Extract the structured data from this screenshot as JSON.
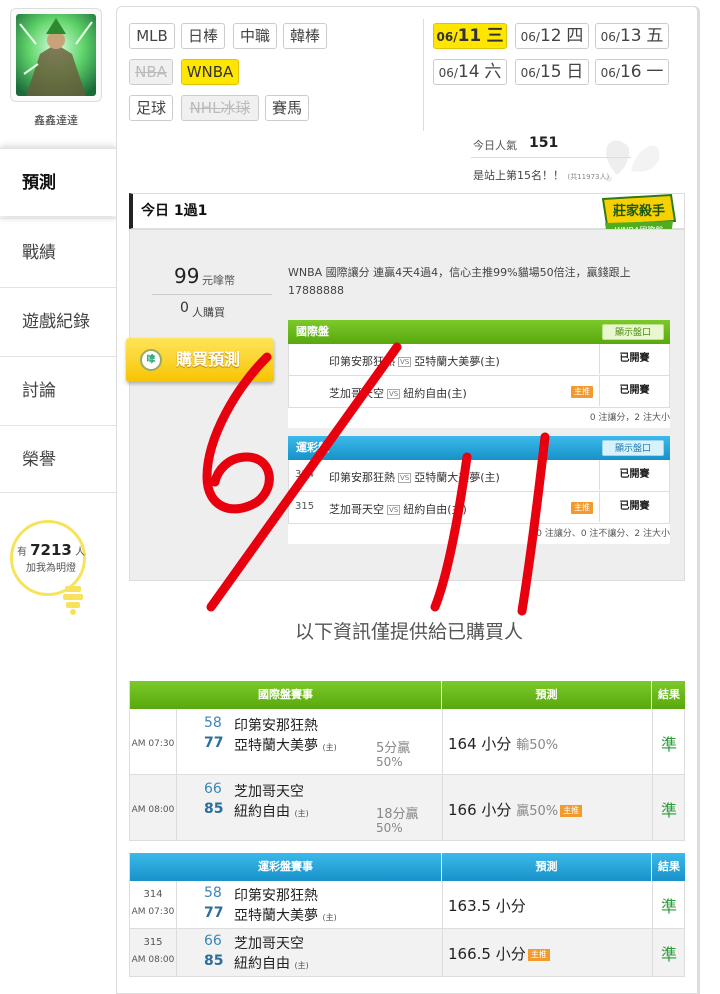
{
  "sidebar": {
    "username": "鑫鑫達達",
    "items": [
      {
        "label": "預測"
      },
      {
        "label": "戰績"
      },
      {
        "label": "遊戲紀錄"
      },
      {
        "label": "討論"
      },
      {
        "label": "榮譽"
      }
    ],
    "bulb": {
      "prefix": "有",
      "count": "7213",
      "suffix": "人",
      "line2": "加我為明燈"
    }
  },
  "sports": [
    {
      "label": "MLB",
      "state": "normal"
    },
    {
      "label": "日棒",
      "state": "normal"
    },
    {
      "label": "中職",
      "state": "normal"
    },
    {
      "label": "韓棒",
      "state": "normal"
    },
    {
      "label": "NBA",
      "state": "disabled"
    },
    {
      "label": "WNBA",
      "state": "active"
    },
    {
      "label": "足球",
      "state": "normal"
    },
    {
      "label": "NHL冰球",
      "state": "disabled"
    },
    {
      "label": "賽馬",
      "state": "normal"
    }
  ],
  "dates": [
    {
      "md": "06/",
      "day": "11",
      "dow": "三",
      "active": true
    },
    {
      "md": "06/",
      "day": "12",
      "dow": "四",
      "active": false
    },
    {
      "md": "06/",
      "day": "13",
      "dow": "五",
      "active": false
    },
    {
      "md": "06/",
      "day": "14",
      "dow": "六",
      "active": false
    },
    {
      "md": "06/",
      "day": "15",
      "dow": "日",
      "active": false
    },
    {
      "md": "06/",
      "day": "16",
      "dow": "一",
      "active": false
    }
  ],
  "stats": {
    "pop_label": "今日人氣",
    "pop_value": "151",
    "rank_text": "是站上第15名！！",
    "rank_small": "(共11973人)"
  },
  "today": {
    "title": "今日 1過1",
    "badge_top": "莊家殺手",
    "badge_sub": "WNBA國際盤",
    "price": "99",
    "price_unit": "元嗱幣",
    "buyers": "0",
    "buyers_unit": "人購買",
    "buy_label": "購買預測",
    "coin": "嗱",
    "description": "WNBA 國際讓分 連贏4天4過4，信心主推99%貓場50倍注，贏錢跟上 17888888",
    "show_btn": "顯示盤口",
    "intl": {
      "header": "國際盤",
      "rows": [
        {
          "num": "",
          "away": "印第安那狂熱",
          "home": "亞特蘭大美夢(主)",
          "status": "已開賽",
          "main": ""
        },
        {
          "num": "",
          "away": "芝加哥天空",
          "home": "紐約自由(主)",
          "status": "已開賽",
          "main": "主推"
        }
      ],
      "footer": "0 注讓分，2 注大小"
    },
    "sports_lottery": {
      "header": "運彩盤",
      "rows": [
        {
          "num": "314",
          "away": "印第安那狂熱",
          "home": "亞特蘭大美夢(主)",
          "status": "已開賽",
          "main": ""
        },
        {
          "num": "315",
          "away": "芝加哥天空",
          "home": "紐約自由(主)",
          "status": "已開賽",
          "main": "主推"
        }
      ],
      "footer": "0 注讓分、0 注不讓分、2 注大小"
    },
    "vs": "VS"
  },
  "handwriting": "6/11",
  "info_message": "以下資訊僅提供給已購買人",
  "results_intl": {
    "headers": {
      "event": "國際盤賽事",
      "pred": "預測",
      "result": "結果"
    },
    "rows": [
      {
        "time": "AM 07:30",
        "n1": "58",
        "n2": "77",
        "t1": "印第安那狂熱",
        "t2": "亞特蘭大美夢",
        "host": "(主)",
        "spread1": "5分贏",
        "spread2": "50%",
        "pred": "164 小分",
        "pred_sub": "輸50%",
        "main": "",
        "result": "準"
      },
      {
        "time": "AM 08:00",
        "n1": "66",
        "n2": "85",
        "t1": "芝加哥天空",
        "t2": "紐約自由",
        "host": "(主)",
        "spread1": "18分贏",
        "spread2": "50%",
        "pred": "166 小分",
        "pred_sub": "贏50%",
        "main": "主推",
        "result": "準"
      }
    ]
  },
  "results_lottery": {
    "headers": {
      "event": "運彩盤賽事",
      "pred": "預測",
      "result": "結果"
    },
    "rows": [
      {
        "gid": "314",
        "time": "AM 07:30",
        "n1": "58",
        "n2": "77",
        "t1": "印第安那狂熱",
        "t2": "亞特蘭大美夢",
        "host": "(主)",
        "pred": "163.5 小分",
        "main": "",
        "result": "準"
      },
      {
        "gid": "315",
        "time": "AM 08:00",
        "n1": "66",
        "n2": "85",
        "t1": "芝加哥天空",
        "t2": "紐約自由",
        "host": "(主)",
        "pred": "166.5 小分",
        "main": "主推",
        "result": "準"
      }
    ]
  },
  "colors": {
    "accent_yellow": "#ffe600",
    "green": "#58a80e",
    "blue": "#1792c9",
    "red_ink": "#e8000f",
    "result_green": "#2b9c3a"
  }
}
